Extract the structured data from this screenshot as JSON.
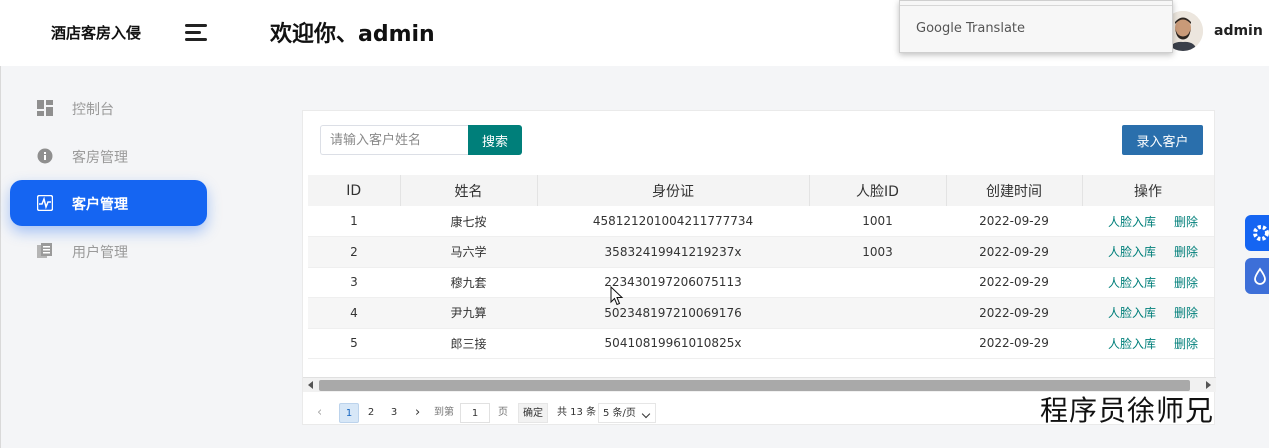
{
  "app": {
    "brand": "酒店客房入侵",
    "welcome": "欢迎你、admin",
    "user": {
      "name": "admin",
      "avatar_icon": "user-avatar"
    }
  },
  "popup": {
    "label": "Google Translate"
  },
  "sidebar": {
    "items": [
      {
        "label": "控制台",
        "icon": "dashboard-icon",
        "active": false
      },
      {
        "label": "客房管理",
        "icon": "info-icon",
        "active": false
      },
      {
        "label": "客户管理",
        "icon": "pulse-icon",
        "active": true
      },
      {
        "label": "用户管理",
        "icon": "copy-icon",
        "active": false
      }
    ]
  },
  "toolbar": {
    "search_placeholder": "请输入客户姓名",
    "search_value": "",
    "search_label": "搜索",
    "add_label": "录入客户"
  },
  "table": {
    "columns": [
      "ID",
      "姓名",
      "身份证",
      "人脸ID",
      "创建时间",
      "操作"
    ],
    "rows": [
      {
        "id": "1",
        "name": "康七按",
        "idcard": "458121201004211777734",
        "face": "1001",
        "created": "2022-09-29"
      },
      {
        "id": "2",
        "name": "马六学",
        "idcard": "35832419941219237x",
        "face": "1003",
        "created": "2022-09-29"
      },
      {
        "id": "3",
        "name": "穆九套",
        "idcard": "223430197206075113",
        "face": "",
        "created": "2022-09-29"
      },
      {
        "id": "4",
        "name": "尹九算",
        "idcard": "502348197210069176",
        "face": "",
        "created": "2022-09-29"
      },
      {
        "id": "5",
        "name": "郎三接",
        "idcard": "50410819961010825x",
        "face": "",
        "created": "2022-09-29"
      }
    ],
    "op_face": "人脸入库",
    "op_delete": "删除"
  },
  "pager": {
    "pages": [
      "1",
      "2",
      "3"
    ],
    "current": "1",
    "goto_label": "到第",
    "goto_value": "1",
    "page_unit": "页",
    "confirm": "确定",
    "total": "共 13 条",
    "page_size": "5 条/页"
  },
  "watermark": "程序员徐师兄",
  "colors": {
    "accent": "#1565f2",
    "teal": "#007f7a",
    "add_button": "#2a6fac"
  }
}
